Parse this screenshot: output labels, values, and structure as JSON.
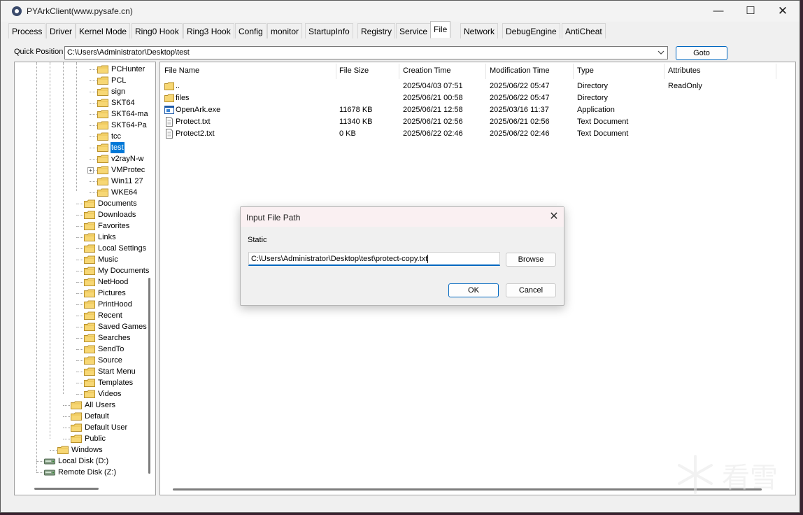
{
  "window": {
    "title": "PYArkClient(www.pysafe.cn)",
    "minimize": "—",
    "maximize": "☐",
    "close": "✕"
  },
  "tabs": [
    {
      "label": "Process"
    },
    {
      "label": "Driver"
    },
    {
      "label": "Kernel Mode"
    },
    {
      "label": "Ring0 Hook"
    },
    {
      "label": "Ring3 Hook"
    },
    {
      "label": "Config"
    },
    {
      "label": "monitor"
    },
    {
      "label": "StartupInfo"
    },
    {
      "label": "Registry"
    },
    {
      "label": "Service"
    },
    {
      "label": "File"
    },
    {
      "label": "Network"
    },
    {
      "label": "DebugEngine"
    },
    {
      "label": "AntiCheat"
    }
  ],
  "active_tab": "File",
  "quick_position": {
    "label": "Quick Position",
    "value": "C:\\Users\\Administrator\\Desktop\\test",
    "goto_label": "Goto"
  },
  "tree": [
    {
      "label": "PCHunter"
    },
    {
      "label": "PCL"
    },
    {
      "label": "sign"
    },
    {
      "label": "SKT64"
    },
    {
      "label": "SKT64-ma"
    },
    {
      "label": "SKT64-Pa"
    },
    {
      "label": "tcc"
    },
    {
      "label": "test"
    },
    {
      "label": "v2rayN-w"
    },
    {
      "label": "VMProtec"
    },
    {
      "label": "Win11 27"
    },
    {
      "label": "WKE64"
    },
    {
      "label": "Documents"
    },
    {
      "label": "Downloads"
    },
    {
      "label": "Favorites"
    },
    {
      "label": "Links"
    },
    {
      "label": "Local Settings"
    },
    {
      "label": "Music"
    },
    {
      "label": "My Documents"
    },
    {
      "label": "NetHood"
    },
    {
      "label": "Pictures"
    },
    {
      "label": "PrintHood"
    },
    {
      "label": "Recent"
    },
    {
      "label": "Saved Games"
    },
    {
      "label": "Searches"
    },
    {
      "label": "SendTo"
    },
    {
      "label": "Source"
    },
    {
      "label": "Start Menu"
    },
    {
      "label": "Templates"
    },
    {
      "label": "Videos"
    },
    {
      "label": "All Users"
    },
    {
      "label": "Default"
    },
    {
      "label": "Default User"
    },
    {
      "label": "Public"
    },
    {
      "label": "Windows"
    },
    {
      "label": "Local Disk (D:)"
    },
    {
      "label": "Remote Disk (Z:)"
    }
  ],
  "tree_selected": "test",
  "file_list": {
    "columns": [
      "File Name",
      "File Size",
      "Creation Time",
      "Modification Time",
      "Type",
      "Attributes"
    ],
    "rows": [
      {
        "name": "..",
        "size": "",
        "created": "2025/04/03 07:51",
        "modified": "2025/06/22 05:47",
        "type": "Directory",
        "attributes": "ReadOnly",
        "icon": "folder-icon"
      },
      {
        "name": "files",
        "size": "",
        "created": "2025/06/21 00:58",
        "modified": "2025/06/22 05:47",
        "type": "Directory",
        "attributes": "",
        "icon": "folder-icon"
      },
      {
        "name": "OpenArk.exe",
        "size": "11678 KB",
        "created": "2025/06/21 12:58",
        "modified": "2025/03/16 11:37",
        "type": "Application",
        "attributes": "",
        "icon": "application-icon"
      },
      {
        "name": "Protect.txt",
        "size": "11340 KB",
        "created": "2025/06/21 02:56",
        "modified": "2025/06/21 02:56",
        "type": "Text Document",
        "attributes": "",
        "icon": "text-file-icon"
      },
      {
        "name": "Protect2.txt",
        "size": "0 KB",
        "created": "2025/06/22 02:46",
        "modified": "2025/06/22 02:46",
        "type": "Text Document",
        "attributes": "",
        "icon": "text-file-icon"
      }
    ]
  },
  "dialog": {
    "title": "Input File Path",
    "close": "✕",
    "static_label": "Static",
    "input_value": "C:\\Users\\Administrator\\Desktop\\test\\protect-copy.txt",
    "browse_label": "Browse",
    "ok_label": "OK",
    "cancel_label": "Cancel"
  },
  "watermark": {
    "text": "看雪"
  },
  "colors": {
    "selection": "#0078d7",
    "accent": "#0067c0",
    "folder": "#f7d774"
  }
}
